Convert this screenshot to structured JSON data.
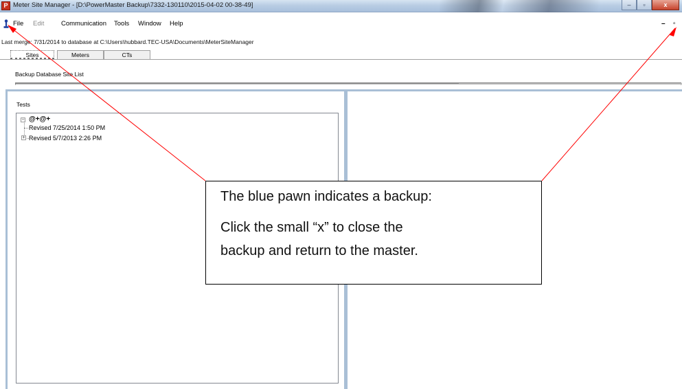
{
  "window": {
    "app_icon_letter": "P",
    "title": "Meter Site Manager - [D:\\PowerMaster Backup\\7332-130110\\2015-04-02 00-38-49]",
    "minimize_glyph": "–",
    "maximize_glyph": "▫",
    "close_glyph": "x"
  },
  "menu": {
    "file": "File",
    "edit": "Edit",
    "communication": "Communication",
    "tools": "Tools",
    "window": "Window",
    "help": "Help",
    "mdi_minimize": "–",
    "mdi_restore": "▫"
  },
  "status": {
    "last_merge": "Last merge: 7/31/2014 to database at C:\\Users\\hubbard.TEC-USA\\Documents\\MeterSiteManager"
  },
  "tabs": [
    {
      "label": "Sites",
      "active": true
    },
    {
      "label": "Meters",
      "active": false
    },
    {
      "label": "CTs",
      "active": false
    }
  ],
  "sites": {
    "list_label": "Backup Database Site List"
  },
  "tests": {
    "label": "Tests",
    "root": "@+@+",
    "root_expander": "−",
    "children": [
      {
        "label": "Revised 7/25/2014 1:50 PM",
        "expander": ""
      },
      {
        "label": "Revised 5/7/2013 2:26 PM",
        "expander": "+"
      }
    ]
  },
  "callout": {
    "line1": "The blue pawn indicates a backup:",
    "line2": "Click the small “x” to close the",
    "line3": "backup and return to the master."
  },
  "colors": {
    "arrow": "#ff0000",
    "pawn": "#1f3fa0",
    "pane_border": "#a9bfd6"
  },
  "icons": {
    "pawn": "pawn-icon",
    "app": "app-icon"
  }
}
